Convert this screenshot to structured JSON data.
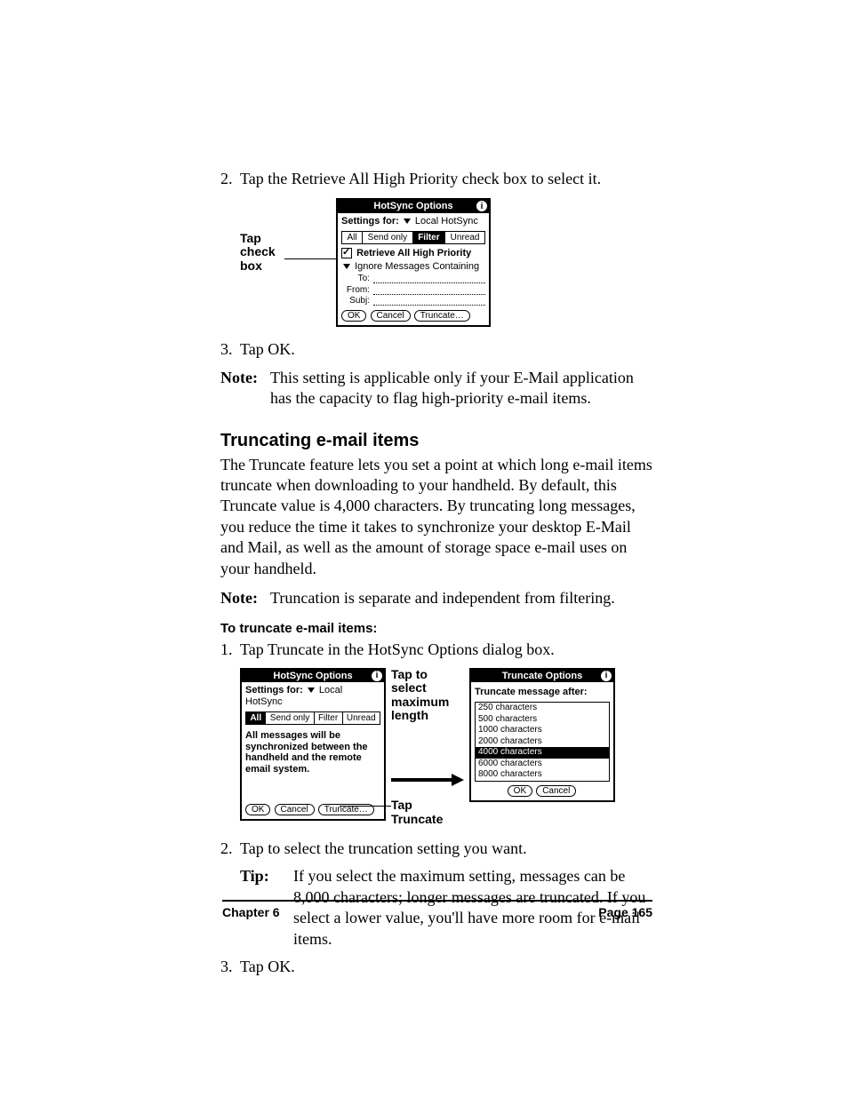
{
  "step2": {
    "num": "2.",
    "text": "Tap the Retrieve All High Priority check box to select it."
  },
  "callout1": {
    "l1": "Tap",
    "l2": "check",
    "l3": "box"
  },
  "palm1": {
    "title": "HotSync Options",
    "settings_label": "Settings for:",
    "settings_value": "Local HotSync",
    "tabs": {
      "all": "All",
      "send": "Send only",
      "filter": "Filter",
      "unread": "Unread"
    },
    "retrieve": "Retrieve All High Priority",
    "ignore": "Ignore Messages Containing",
    "to": "To:",
    "from": "From:",
    "subj": "Subj:",
    "ok": "OK",
    "cancel": "Cancel",
    "truncate": "Truncate…"
  },
  "step3": {
    "num": "3.",
    "text": "Tap OK."
  },
  "note1": {
    "label": "Note:",
    "text": "This setting is applicable only if your E-Mail application has the capacity to flag high-priority e-mail items."
  },
  "heading": "Truncating e-mail items",
  "para1": "The Truncate feature lets you set a point at which long e-mail items truncate when downloading to your handheld. By default, this Truncate value is 4,000 characters. By truncating long messages, you reduce the time it takes to synchronize your desktop E-Mail and Mail, as well as the amount of storage space e-mail uses on your handheld.",
  "note2": {
    "label": "Note:",
    "text": "Truncation is separate and independent from filtering."
  },
  "subhead": "To truncate e-mail items:",
  "step1b": {
    "num": "1.",
    "text": "Tap Truncate in the HotSync Options dialog box."
  },
  "palm2": {
    "title": "HotSync Options",
    "settings_label": "Settings for:",
    "settings_value": "Local HotSync",
    "tabs": {
      "all": "All",
      "send": "Send only",
      "filter": "Filter",
      "unread": "Unread"
    },
    "sync_msg": "All messages will be synchronized between the handheld and the remote email system.",
    "ok": "OK",
    "cancel": "Cancel",
    "truncate": "Truncate…"
  },
  "callout2a": {
    "l1": "Tap to",
    "l2": "select",
    "l3": "maximum",
    "l4": "length"
  },
  "callout2b": {
    "l1": "Tap",
    "l2": "Truncate"
  },
  "palm3": {
    "title": "Truncate Options",
    "label": "Truncate message after:",
    "opts": [
      "250 characters",
      "500 characters",
      "1000 characters",
      "2000 characters",
      "4000 characters",
      "6000 characters",
      "8000 characters"
    ],
    "selected_index": 4,
    "ok": "OK",
    "cancel": "Cancel"
  },
  "step2b": {
    "num": "2.",
    "text": "Tap to select the truncation setting you want."
  },
  "tip": {
    "label": "Tip:",
    "text": "If you select the maximum setting, messages can be 8,000 characters; longer messages are truncated. If you select a lower value, you'll have more room for e-mail items."
  },
  "step3b": {
    "num": "3.",
    "text": "Tap OK."
  },
  "footer": {
    "left": "Chapter 6",
    "right": "Page 165"
  }
}
